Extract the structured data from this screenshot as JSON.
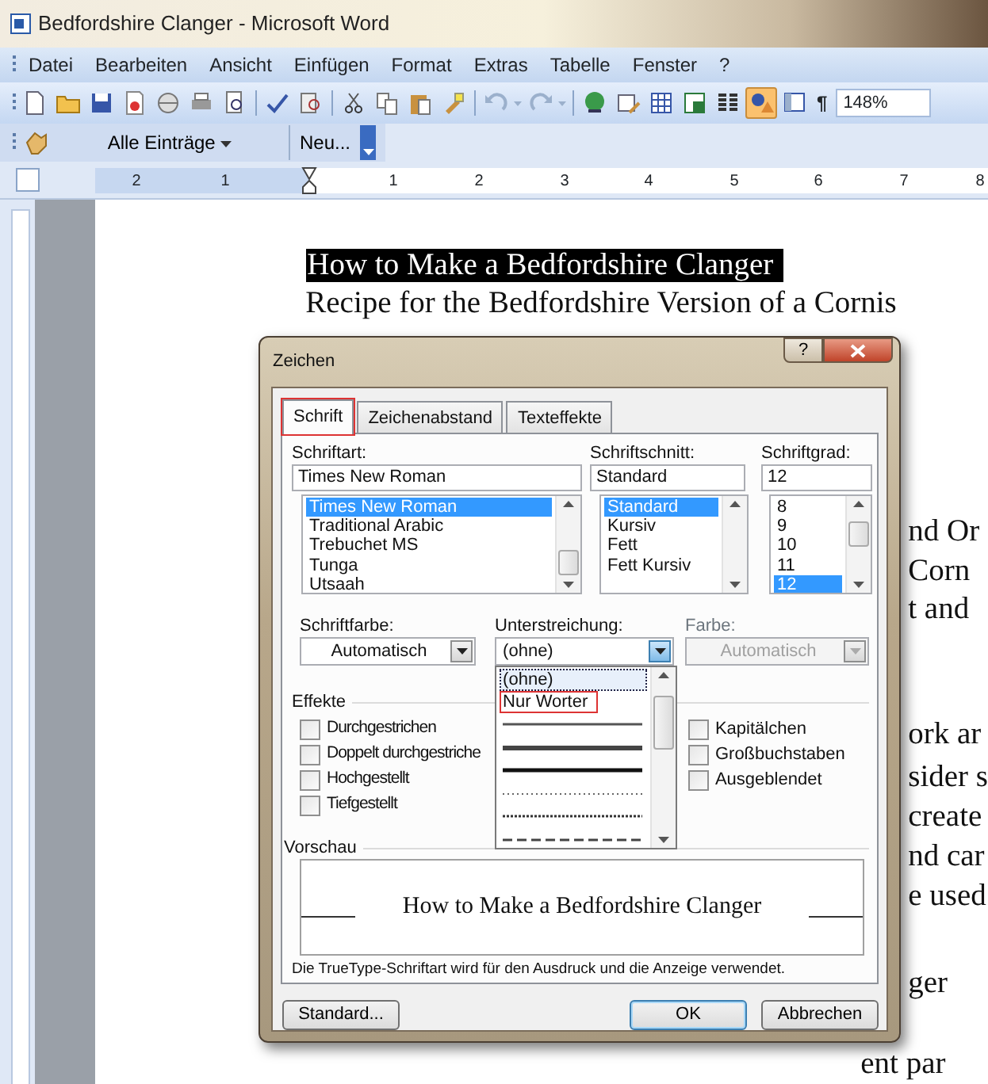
{
  "window": {
    "title": "Bedfordshire Clanger - Microsoft Word"
  },
  "menu": [
    "Datei",
    "Bearbeiten",
    "Ansicht",
    "Einfügen",
    "Format",
    "Extras",
    "Tabelle",
    "Fenster",
    "?"
  ],
  "toolbar": {
    "buttons": [
      {
        "active": false
      },
      {
        "active": false
      },
      {
        "active": false
      },
      {
        "active": false
      },
      {
        "active": false
      },
      {
        "active": false
      },
      {
        "active": false
      },
      {
        "active": false
      },
      {
        "active": false
      },
      {
        "active": false
      },
      {
        "active": false
      },
      {
        "active": false
      },
      {
        "active": false
      },
      {
        "active": false
      },
      {
        "active": false
      },
      {
        "active": false
      },
      {
        "active": false
      },
      {
        "active": false
      },
      {
        "active": false
      },
      {
        "active": false
      },
      {
        "active": true
      },
      {
        "active": false
      }
    ],
    "pilcrow": "¶",
    "zoom": "148%"
  },
  "toolbar2": {
    "entries_button": "Alle Einträge",
    "new_button": "Neu..."
  },
  "ruler": {
    "numbers": [
      "2",
      "1",
      "1",
      "2",
      "3",
      "4",
      "5",
      "6",
      "7",
      "8"
    ]
  },
  "document": {
    "heading": {
      "text": "How to Make a Bedfordshire Clanger",
      "selected": true
    },
    "subtitle": "Recipe for the Bedfordshire Version of a Cornis",
    "fragments": [
      "nd Or",
      "Corn",
      "t and",
      "ork ar",
      "sider s",
      "create",
      "nd car",
      "e used",
      "ger",
      "ent par"
    ]
  },
  "dialog": {
    "title": "Zeichen",
    "help_button": "?",
    "tabs": [
      {
        "label": "Schrift",
        "selected": true,
        "marked": true
      },
      {
        "label": "Zeichenabstand",
        "selected": false,
        "marked": false
      },
      {
        "label": "Texteffekte",
        "selected": false,
        "marked": false
      }
    ],
    "font": {
      "label": "Schriftart:",
      "value": "Times New Roman",
      "items": [
        {
          "label": "Times New Roman",
          "selected": true
        },
        {
          "label": "Traditional Arabic",
          "selected": false
        },
        {
          "label": "Trebuchet MS",
          "selected": false
        },
        {
          "label": "Tunga",
          "selected": false
        },
        {
          "label": "Utsaah",
          "selected": false
        }
      ]
    },
    "style": {
      "label": "Schriftschnitt:",
      "value": "Standard",
      "items": [
        {
          "label": "Standard",
          "selected": true
        },
        {
          "label": "Kursiv",
          "selected": false
        },
        {
          "label": "Fett",
          "selected": false
        },
        {
          "label": "Fett Kursiv",
          "selected": false
        }
      ]
    },
    "size": {
      "label": "Schriftgrad:",
      "value": "12",
      "items": [
        {
          "label": "8",
          "selected": false
        },
        {
          "label": "9",
          "selected": false
        },
        {
          "label": "10",
          "selected": false
        },
        {
          "label": "11",
          "selected": false
        },
        {
          "label": "12",
          "selected": true
        }
      ]
    },
    "font_color": {
      "label": "Schriftfarbe:",
      "value": "Automatisch",
      "disabled": false
    },
    "underline": {
      "label": "Unterstreichung:",
      "value": "(ohne)",
      "options": [
        {
          "kind": "text",
          "label": "(ohne)",
          "selected": true,
          "marked": false
        },
        {
          "kind": "text",
          "label": "Nur Worter",
          "selected": false,
          "marked": true
        },
        {
          "kind": "solid",
          "selected": false,
          "marked": false
        },
        {
          "kind": "double",
          "selected": false,
          "marked": false
        },
        {
          "kind": "thick",
          "selected": false,
          "marked": false
        },
        {
          "kind": "dotted",
          "selected": false,
          "marked": false
        },
        {
          "kind": "dense-dotted",
          "selected": false,
          "marked": false
        },
        {
          "kind": "dashed",
          "selected": false,
          "marked": false
        }
      ]
    },
    "underline_color": {
      "label": "Farbe:",
      "value": "Automatisch",
      "disabled": true
    },
    "effects": {
      "label": "Effekte",
      "left": [
        {
          "label": "Durchgestrichen",
          "checked": false
        },
        {
          "label": "Doppelt durchgestriche",
          "checked": false
        },
        {
          "label": "Hochgestellt",
          "checked": false
        },
        {
          "label": "Tiefgestellt",
          "checked": false
        }
      ],
      "right": [
        {
          "label": "Kapitälchen",
          "checked": false
        },
        {
          "label": "Großbuchstaben",
          "checked": false
        },
        {
          "label": "Ausgeblendet",
          "checked": false
        }
      ]
    },
    "preview": {
      "label": "Vorschau",
      "text": "How to Make a Bedfordshire Clanger"
    },
    "note": "Die TrueType-Schriftart wird für den Ausdruck und die Anzeige verwendet.",
    "buttons": [
      {
        "label": "Standard...",
        "default": false
      },
      {
        "label": "OK",
        "default": true
      },
      {
        "label": "Abbrechen",
        "default": false
      }
    ]
  }
}
